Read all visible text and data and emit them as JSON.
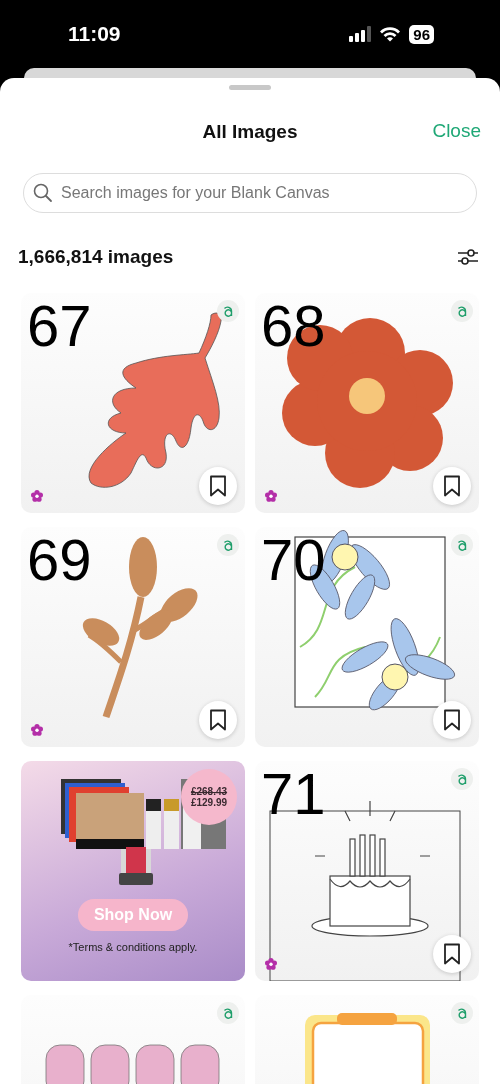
{
  "status_bar": {
    "time": "11:09",
    "battery": "96"
  },
  "sheet": {
    "title": "All Images",
    "close": "Close"
  },
  "search": {
    "placeholder": "Search images for your Blank Canvas"
  },
  "results": {
    "count": "1,666,814 images"
  },
  "tiles": [
    {
      "kind": "leaf",
      "number": "67",
      "premium": true,
      "bookmark": true
    },
    {
      "kind": "flower",
      "number": "68",
      "premium": true,
      "bookmark": true
    },
    {
      "kind": "sprig",
      "number": "69",
      "premium": true,
      "bookmark": true
    },
    {
      "kind": "daisies",
      "number": "70",
      "premium": false,
      "bookmark": true
    },
    {
      "kind": "ad",
      "old_price": "£268.43",
      "price": "£129.99",
      "button": "Shop Now",
      "terms": "*Terms & conditions apply."
    },
    {
      "kind": "cake",
      "number": "71",
      "premium": true,
      "bookmark": true
    },
    {
      "kind": "mama",
      "premium": false
    },
    {
      "kind": "frame",
      "premium": false
    }
  ]
}
